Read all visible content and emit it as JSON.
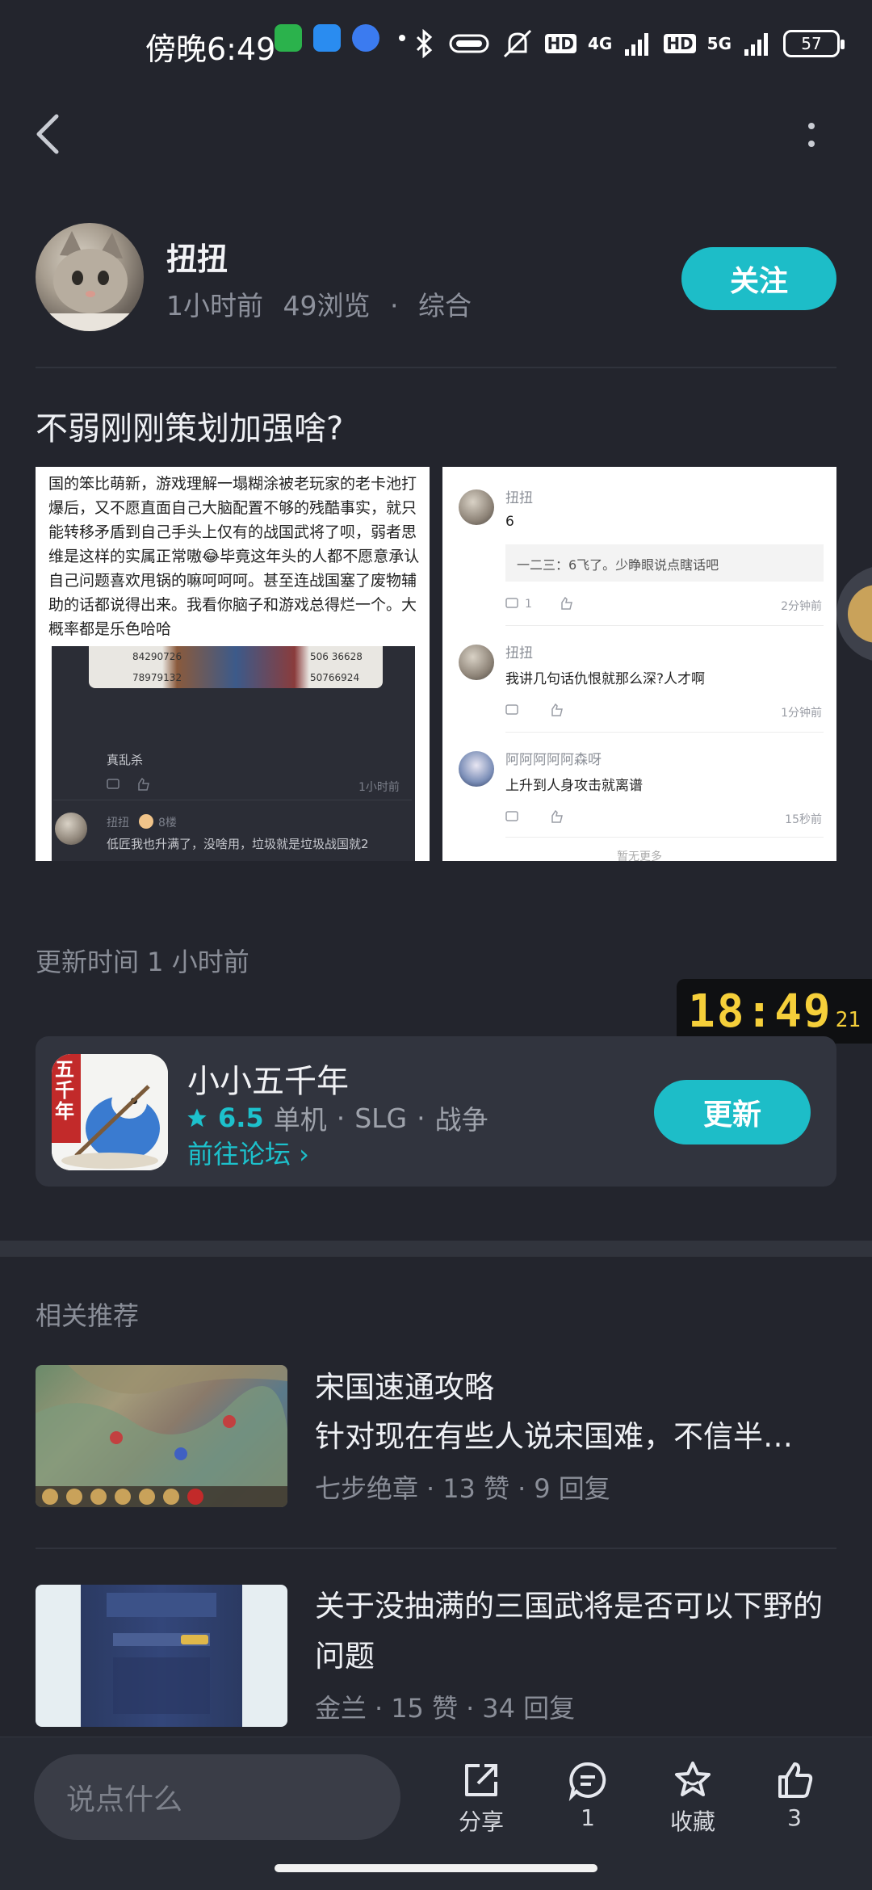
{
  "status_bar": {
    "time": "傍晚6:49",
    "network1": "4G",
    "network2": "5G",
    "hd1": "HD",
    "hd2": "HD",
    "battery": "57"
  },
  "author": {
    "name": "扭扭",
    "time": "1小时前",
    "views": "49浏览",
    "category_sep": "·",
    "category": "综合",
    "follow_label": "关注"
  },
  "post": {
    "title": "不弱刚刚策划加强啥?",
    "image_left": {
      "text": "国的笨比萌新，游戏理解一塌糊涂被老玩家的老卡池打爆后，又不愿直面自己大脑配置不够的残酷事实，就只能转移矛盾到自己手头上仅有的战国武将了呗，弱者思维是这样的实属正常嗷😂毕竟这年头的人都不愿意承认自己问题喜欢甩锅的嘛呵呵呵。甚至连战国塞了废物辅助的话都说得出来。我看你脑子和游戏总得烂一个。大概率都是乐色哈哈",
      "num1": "84290726",
      "num2": "78979132",
      "num3": "506 36628",
      "num4": "50766924",
      "comment1": "真乱杀",
      "comment1_time": "1小时前",
      "reply_name": "扭扭",
      "reply_floor": "8楼",
      "reply_text": "低匠我也升满了，没啥用，垃圾就是垃圾战国就2"
    },
    "image_right": {
      "comments": [
        {
          "name": "扭扭",
          "text": "6",
          "quote": "一二三：6飞了。少睁眼说点瞎话吧",
          "reply_count": "1",
          "time": "2分钟前"
        },
        {
          "name": "扭扭",
          "text": "我讲几句话仇恨就那么深?人才啊",
          "time": "1分钟前"
        },
        {
          "name": "阿阿阿阿阿森呀",
          "text": "上升到人身攻击就离谱",
          "time": "15秒前"
        }
      ],
      "footer": "暂无更多"
    }
  },
  "update_time": "更新时间 1 小时前",
  "clock": {
    "hm": "18:49",
    "sec": "21"
  },
  "game": {
    "name": "小小五千年",
    "rating": "6.5",
    "tags": [
      "单机",
      "SLG",
      "战争"
    ],
    "tag_sep": "·",
    "forum_link": "前往论坛 ›",
    "update_label": "更新",
    "icon_text": "五千年"
  },
  "recommendations": {
    "title": "相关推荐",
    "items": [
      {
        "title": "宋国速通攻略",
        "subtitle": "针对现在有些人说宋国难，不信半…",
        "author": "七步绝章",
        "likes": "13 赞",
        "replies": "9 回复"
      },
      {
        "title": "关于没抽满的三国武将是否可以下野的问题",
        "author": "金兰",
        "likes": "15 赞",
        "replies": "34 回复"
      }
    ]
  },
  "bottom_bar": {
    "input_placeholder": "说点什么",
    "share_label": "分享",
    "comment_count": "1",
    "favorite_label": "收藏",
    "like_count": "3"
  },
  "colors": {
    "accent": "#1dbdc8",
    "background": "#23252d",
    "card": "#31343e",
    "clock": "#f5cf3a"
  }
}
